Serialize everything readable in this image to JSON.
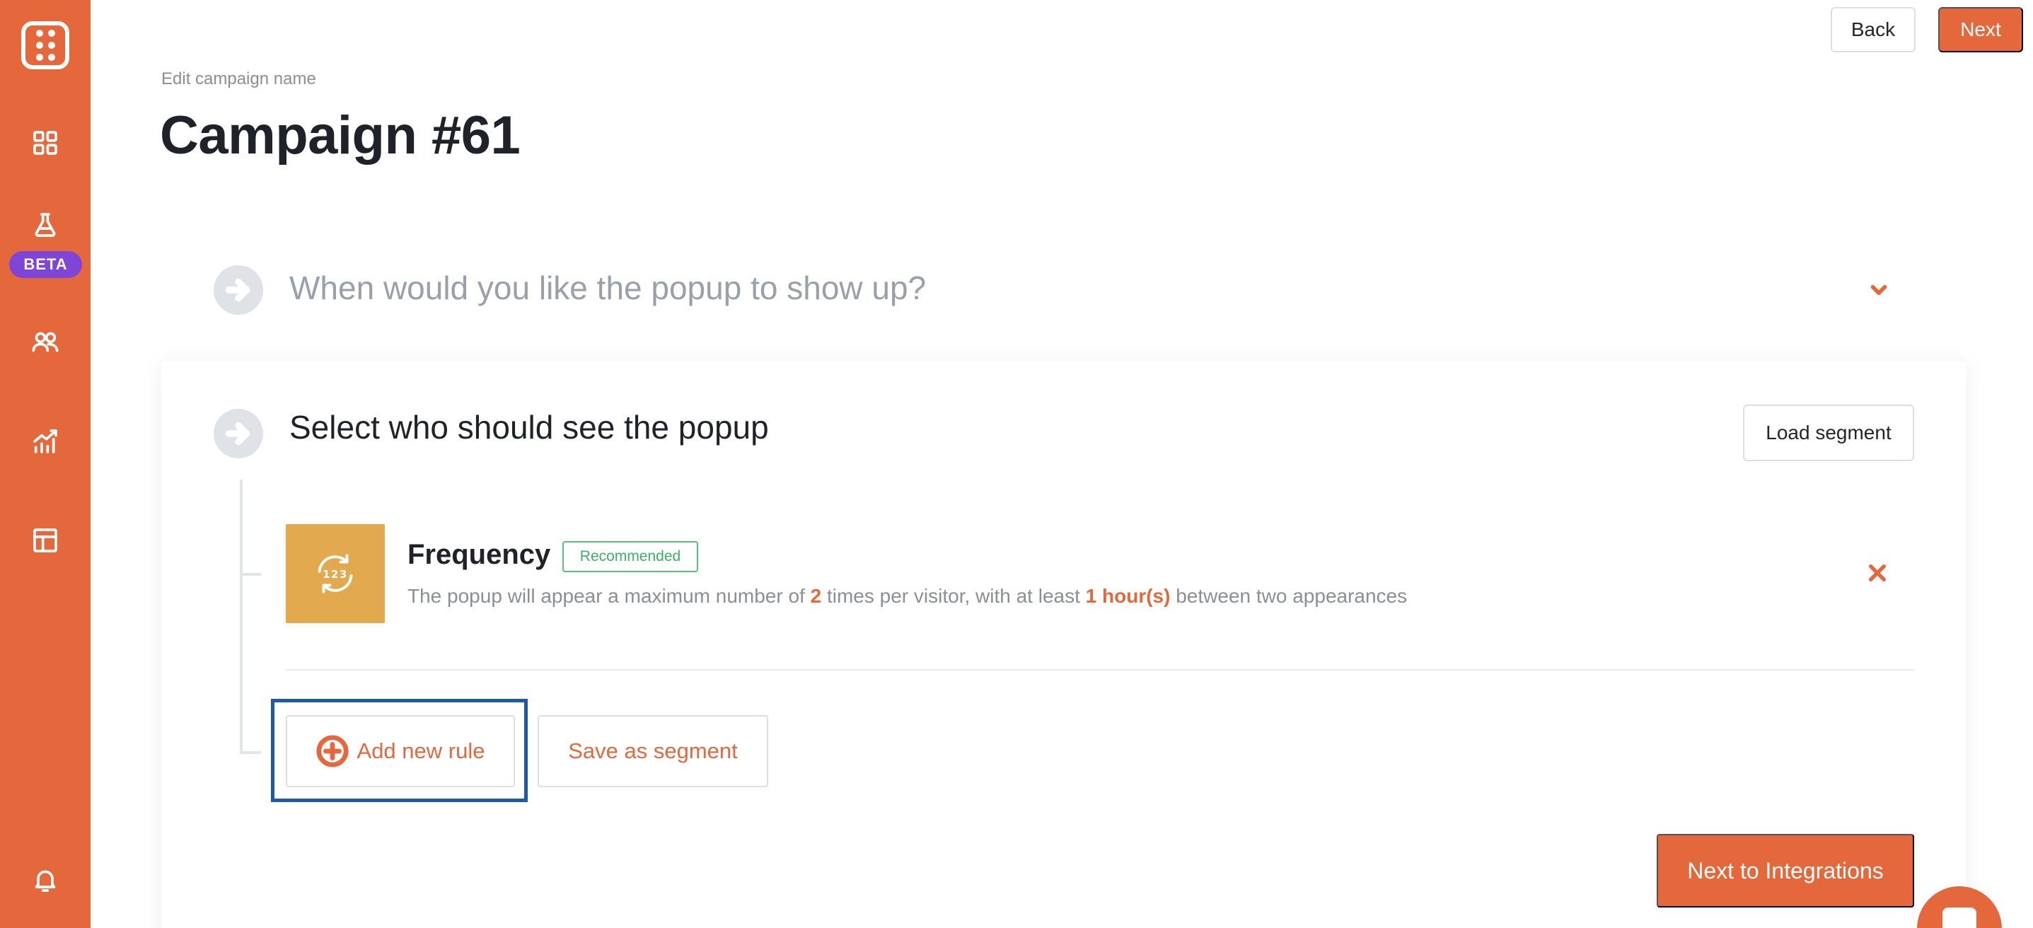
{
  "brand": {
    "accent": "#e4683c",
    "beta_color": "#7e45d6",
    "icon_tile": "#e3a94f",
    "focus_ring": "#1e5aa8"
  },
  "sidebar": {
    "logo_icon": "dice-logo-icon",
    "items": [
      {
        "icon": "dashboard-grid-icon"
      },
      {
        "icon": "flask-icon",
        "badge": "BETA"
      },
      {
        "icon": "users-icon"
      },
      {
        "icon": "analytics-chart-icon"
      },
      {
        "icon": "layout-template-icon"
      }
    ],
    "bottom_icon": "bell-icon"
  },
  "header": {
    "edit_label": "Edit campaign name",
    "title": "Campaign #61",
    "back_label": "Back",
    "next_label": "Next"
  },
  "steps": {
    "step1": {
      "title": "When would you like the popup to show up?",
      "expanded": false
    },
    "step2": {
      "title": "Select who should see the popup",
      "load_segment_label": "Load segment",
      "rule": {
        "icon": "frequency-123-icon",
        "title": "Frequency",
        "badge": "Recommended",
        "desc_prefix": "The popup will appear a maximum number of ",
        "max_times": "2",
        "desc_middle": " times per visitor, with at least ",
        "interval": "1 hour(s)",
        "desc_suffix": " between two appearances"
      },
      "add_rule_label": "Add new rule",
      "save_segment_label": "Save as segment",
      "next_integrations_label": "Next to Integrations"
    }
  }
}
